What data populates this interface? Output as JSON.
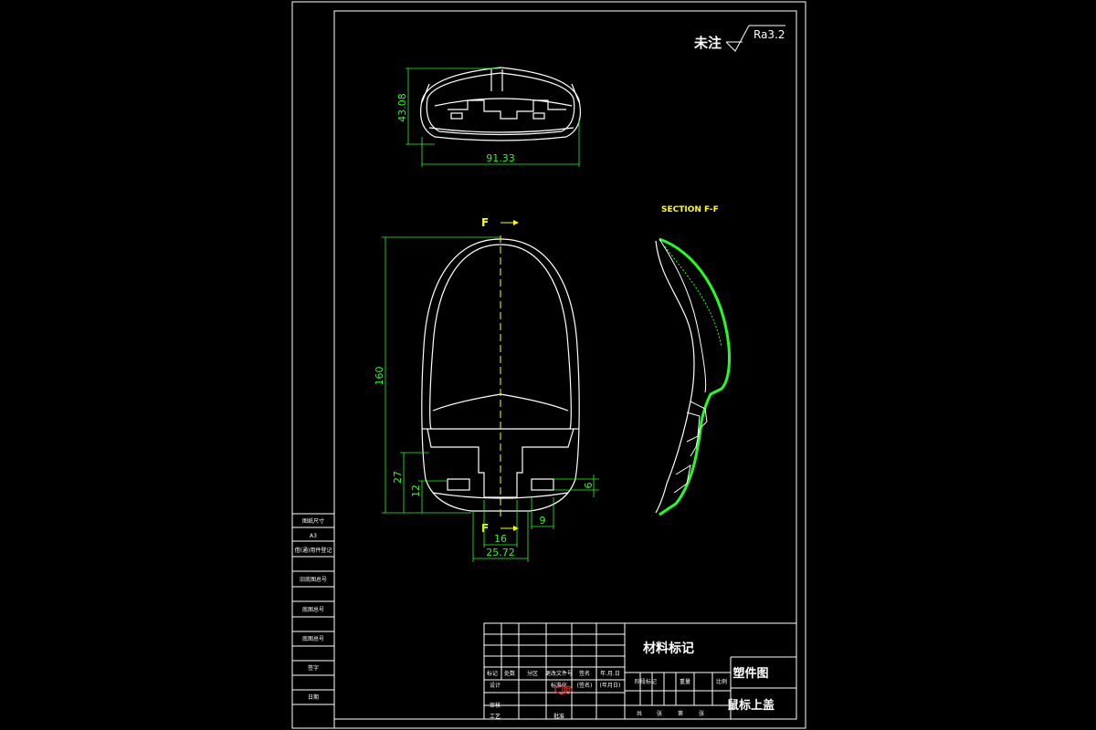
{
  "drawing": {
    "surface_note": "未注",
    "roughness": "Ra3.2",
    "section_label": "SECTION F-F",
    "section_mark": "F",
    "dimensions": {
      "top_width": "91.33",
      "top_height": "43.08",
      "overall_length": "160",
      "rear_27": "27",
      "rear_12": "12",
      "notch_6": "6",
      "notch_9": "9",
      "slot_16": "16",
      "slot_2572": "25.72"
    }
  },
  "left_table": {
    "rows": [
      "图纸尺寸",
      "A3",
      "借(通)用件登记",
      "旧底图总号",
      "底图总号",
      "签字",
      "日期",
      ""
    ]
  },
  "title_block": {
    "material_mark": "材料标记",
    "drawing_type": "塑件图",
    "part_name": "鼠标上盖",
    "header_row": [
      "标记",
      "处数",
      "分区",
      "更改文件号",
      "签名",
      "年.月.日"
    ],
    "row_design": "设计",
    "row_standard": "标准化",
    "row_sign_small": "(签名)",
    "row_date_small": "(年月日)",
    "row_review": "审核",
    "row_process": "工艺",
    "row_approve": "批准",
    "stage_labels": [
      "阶段标记",
      "重量",
      "比例"
    ],
    "sheet_labels": [
      "共",
      "张",
      "第",
      "张"
    ]
  },
  "colors": {
    "outline": "#ffffff",
    "dimension": "#21ff21",
    "annotation": "#ffff00",
    "hatch": "#21ff21"
  }
}
